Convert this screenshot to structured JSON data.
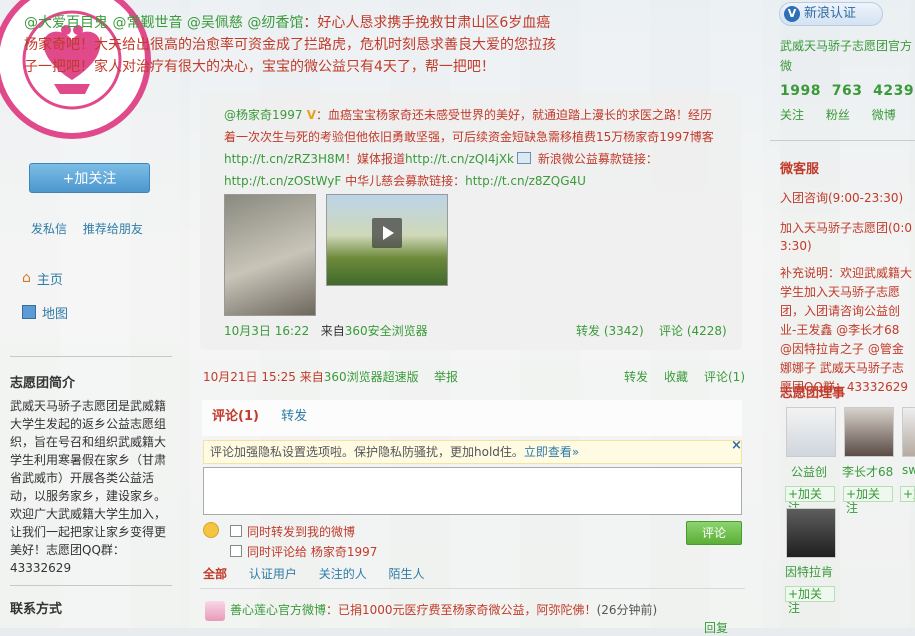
{
  "left": {
    "logo_text_top": "用爱让世界更美好",
    "logo_text_bottom": "“天马骄子”志愿团",
    "follow_button": "+加关注",
    "send_message": "发私信",
    "recommend": "推荐给朋友",
    "nav_home": "主页",
    "nav_map": "地图",
    "intro_title": "志愿团简介",
    "intro_text": "武威天马骄子志愿团是武威籍大学生发起的返乡公益志愿组织，旨在号召和组织武威籍大学生利用寒暑假在家乡（甘肃省武威市）开展各类公益活动，以服务家乡，建设家乡。欢迎广大武威籍大学生加入，让我们一起把家让家乡变得更美好！志愿团QQ群：43332629",
    "contact_title": "联系方式"
  },
  "post": {
    "mentions": "@大爱百目鬼 @常觐世音 @吴佩慈 @纫香馆",
    "text": "：好心人恳求携手挽救甘肃山区6岁血癌杨家奇吧！大夫给出很高的治愈率可资金成了拦路虎，危机时刻恳求善良大爱的您拉孩子一把吧！家人对治疗有很大的决心，宝宝的微公益只有4天了，帮一把吧！",
    "time": "10月21日 15:25",
    "source_prefix": "来自",
    "source": "360浏览器超速版",
    "report": "举报",
    "forward": "转发",
    "favorite": "收藏",
    "comment_count": "评论(1)"
  },
  "repost": {
    "author": "@杨家奇1997",
    "text1": "：血癌宝宝杨家奇还未感受世界的美好，就通迫踏上漫长的求医之路！经历着一次次生与死的考验但他依旧勇敢坚强，可后续资金短缺急需移植费15万杨家奇1997博客",
    "link1": "http://t.cn/zRZ3H8M",
    "text2": "！媒体报道",
    "link2": "http://t.cn/zQI4jXk",
    "text3": " 新浪微公益募款链接：",
    "link3": "http://t.cn/zOStWyF",
    "text4": " 中华儿慈会募款链接：",
    "link4": "http://t.cn/z8ZQG4U",
    "time": "10月3日 16:22",
    "source_prefix": "来自",
    "source": "360安全浏览器",
    "forward": "转发 (3342)",
    "comment": "评论 (4228)"
  },
  "comments": {
    "tab_comment": "评论(1)",
    "tab_forward": "转发",
    "notice_text": "评论加强隐私设置选项啦。保护隐私防骚扰，更加hold住。",
    "notice_link": "立即查看»",
    "close": "×",
    "option1": "同时转发到我的微博",
    "option2": "同时评论给 杨家奇1997",
    "submit": "评论",
    "filters": [
      "全部",
      "认证用户",
      "关注的人",
      "陌生人"
    ],
    "item_author": "善心莲心官方微博",
    "item_text": "：已捐1000元医疗费至杨家奇微公益，阿弥陀佛！",
    "item_time": "(26分钟前)",
    "reply": "回复"
  },
  "right": {
    "verify_badge": "V",
    "verify_label": "新浪认证",
    "org_name": "武威天马骄子志愿团官方微",
    "stats_numbers": "1998  763  4239",
    "stat_follow": "关注",
    "stat_fans": "粉丝",
    "stat_weibo": "微博",
    "service_title": "微客服",
    "service1": "入团咨询(9:00-23:30)",
    "service2": "加入天马骄子志愿团(0:0",
    "service2b": "3:30)",
    "supplement": "补充说明：欢迎武威籍大学生加入天马骄子志愿团，入团请咨询公益创业-王发鑫 @李长才68 @因特拉肯之子 @管金娜娜子 武威天马骄子志愿团QQ群：43332629",
    "board_title": "志愿团理事",
    "members": [
      {
        "name": "公益创",
        "add": "+加关注"
      },
      {
        "name": "李长才68",
        "add": "+加关注"
      },
      {
        "name": "sw",
        "add": "+加"
      },
      {
        "name": "因特拉肯",
        "add": "+加关注"
      }
    ]
  }
}
